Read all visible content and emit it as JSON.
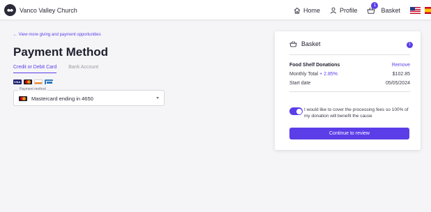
{
  "header": {
    "brand_name": "Vanco Valley Church",
    "nav": {
      "home": "Home",
      "profile": "Profile",
      "basket": "Basket",
      "basket_badge": "1"
    }
  },
  "main": {
    "back_link": "← View more giving and payment opportunities",
    "title": "Payment Method",
    "tabs": [
      {
        "label": "Credit or Debit Card",
        "active": true
      },
      {
        "label": "Bank Account",
        "active": false
      }
    ],
    "payment_method": {
      "legend": "Payment method",
      "value": "Mastercard ending in 4650"
    }
  },
  "basket": {
    "title": "Basket",
    "count": "1",
    "item": {
      "name": "Food Shelf Donations",
      "remove_label": "Remove",
      "monthly_label": "Monthly Total",
      "monthly_fee": "+ 2.85%",
      "monthly_value": "$102.85",
      "start_label": "Start date",
      "start_value": "05/05/2024"
    },
    "cover_fees": {
      "enabled": true,
      "text": "I would like to cover the processing fees so 100% of my donation will benefit the cause"
    },
    "continue_label": "Continue to review"
  },
  "colors": {
    "accent": "#5b3ee8"
  }
}
